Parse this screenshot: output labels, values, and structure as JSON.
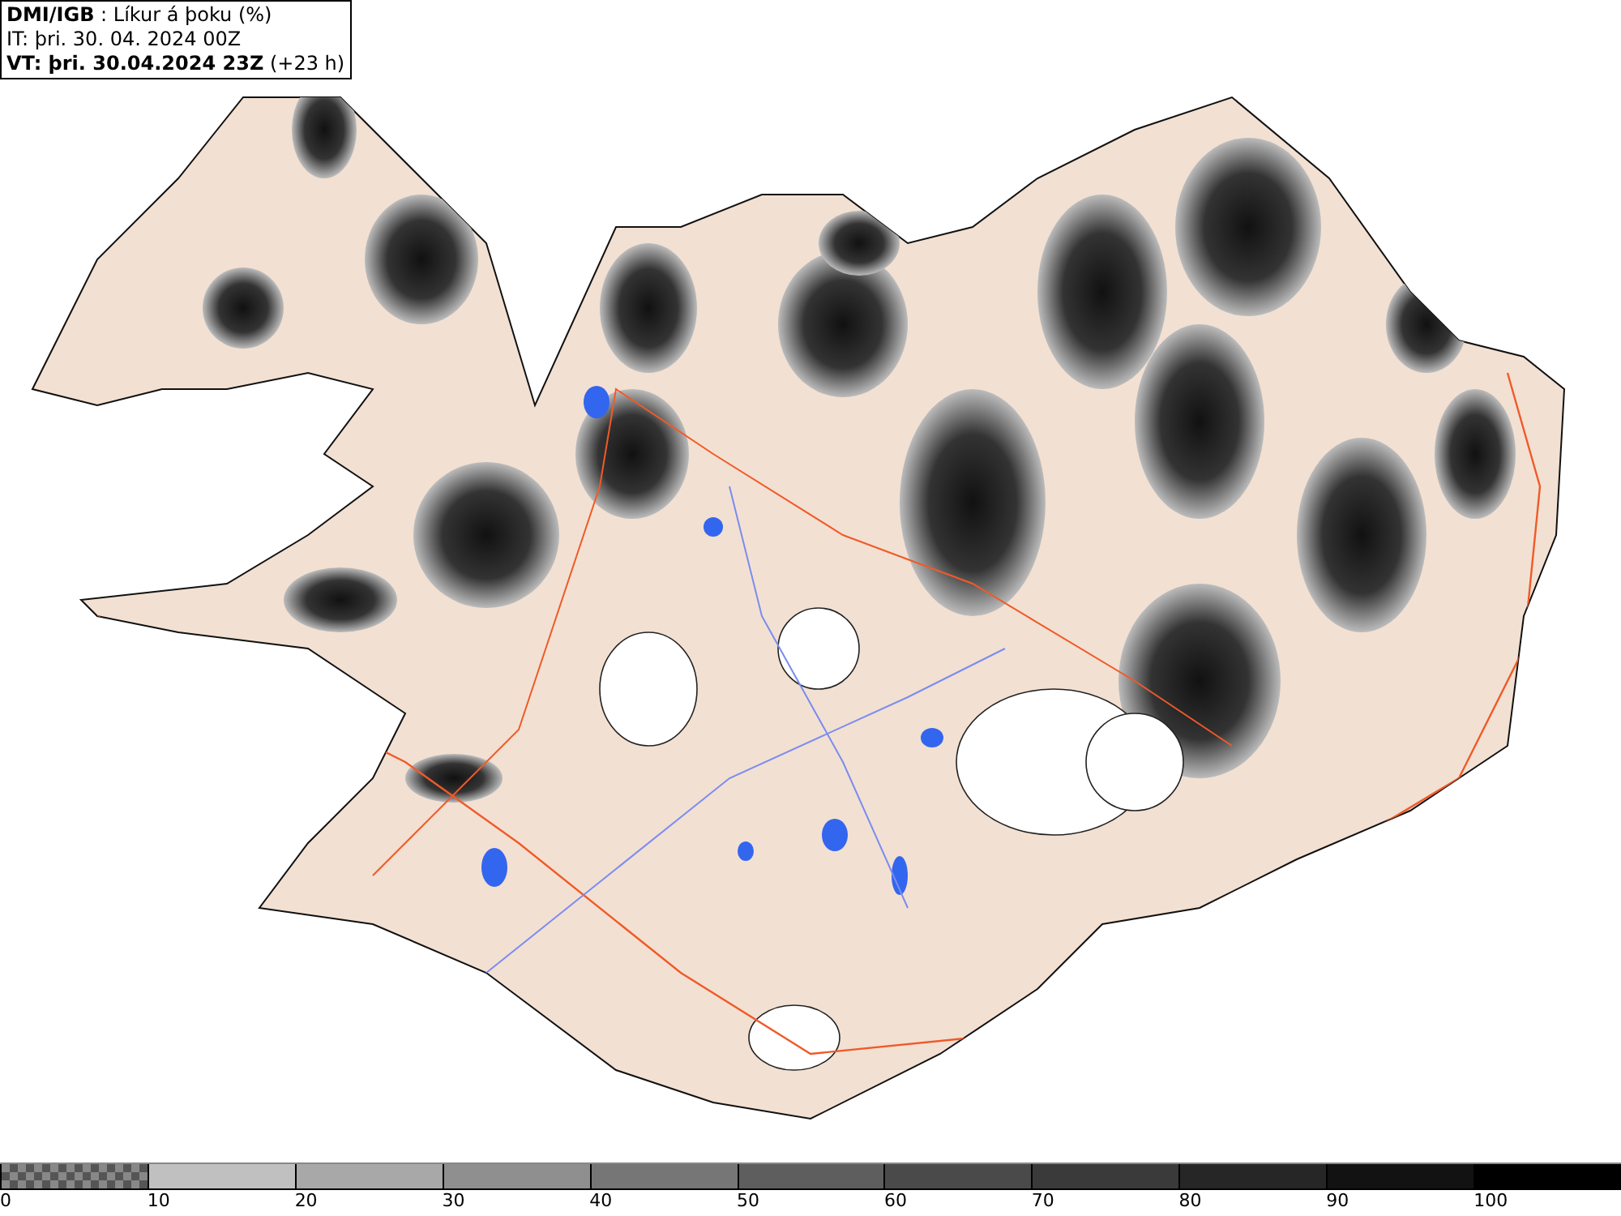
{
  "header": {
    "lines": [
      "**DMI/IGB** : Líkur á þoku (%)",
      "IT: þri. 30. 04. 2024 00Z",
      "**VT: þri. 30.04.2024 23Z** (+23 h)"
    ]
  },
  "legend": [
    {
      "label": "0",
      "kind": "checker",
      "color": "#555555"
    },
    {
      "label": "10",
      "kind": "solid",
      "color": "#c0c0c0"
    },
    {
      "label": "20",
      "kind": "solid",
      "color": "#a8a8a8"
    },
    {
      "label": "30",
      "kind": "solid",
      "color": "#8f8f8f"
    },
    {
      "label": "40",
      "kind": "solid",
      "color": "#767676"
    },
    {
      "label": "50",
      "kind": "solid",
      "color": "#5e5e5e"
    },
    {
      "label": "60",
      "kind": "solid",
      "color": "#4a4a4a"
    },
    {
      "label": "70",
      "kind": "solid",
      "color": "#3a3a3a"
    },
    {
      "label": "80",
      "kind": "solid",
      "color": "#262626"
    },
    {
      "label": "90",
      "kind": "solid",
      "color": "#121212"
    },
    {
      "label": "100",
      "kind": "solid",
      "color": "#000000"
    }
  ]
}
